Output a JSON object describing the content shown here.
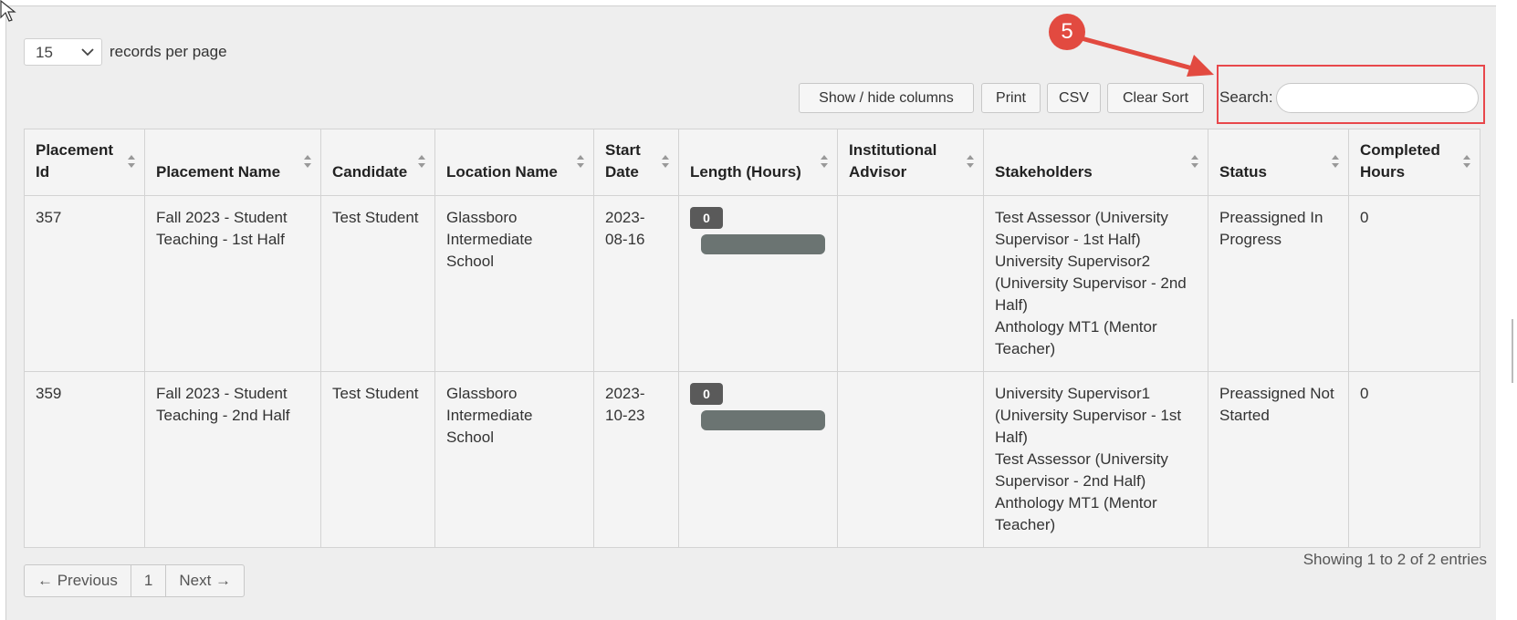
{
  "length_menu": {
    "value": "15",
    "label": "records per page"
  },
  "toolbar": {
    "show_hide": "Show / hide columns",
    "print": "Print",
    "csv": "CSV",
    "clear_sort": "Clear Sort",
    "search_label": "Search:",
    "search_value": ""
  },
  "annotation": {
    "step": "5",
    "color": "#e24a40"
  },
  "table": {
    "headers": [
      "Placement Id",
      "Placement Name",
      "Candidate",
      "Location Name",
      "Start Date",
      "Length (Hours)",
      "Institutional Advisor",
      "Stakeholders",
      "Status",
      "Completed Hours"
    ],
    "rows": [
      {
        "id": "357",
        "name": "Fall 2023 - Student Teaching - 1st Half",
        "candidate": "Test Student",
        "location": "Glassboro Intermediate School",
        "start": "2023-08-16",
        "hours": "0",
        "advisor": "",
        "stakeholders": [
          "Test Assessor (University Supervisor - 1st Half)",
          "University Supervisor2 (University Supervisor - 2nd Half)",
          "Anthology MT1 (Mentor Teacher)"
        ],
        "status": "Preassigned In Progress",
        "completed": "0"
      },
      {
        "id": "359",
        "name": "Fall 2023 - Student Teaching - 2nd Half",
        "candidate": "Test Student",
        "location": "Glassboro Intermediate School",
        "start": "2023-10-23",
        "hours": "0",
        "advisor": "",
        "stakeholders": [
          "University Supervisor1 (University Supervisor - 1st Half)",
          "Test Assessor (University Supervisor - 2nd Half)",
          "Anthology MT1 (Mentor Teacher)"
        ],
        "status": "Preassigned Not Started",
        "completed": "0"
      }
    ]
  },
  "footer": {
    "showing": "Showing 1 to 2 of 2 entries",
    "previous": "← Previous",
    "page": "1",
    "next": "Next →"
  }
}
